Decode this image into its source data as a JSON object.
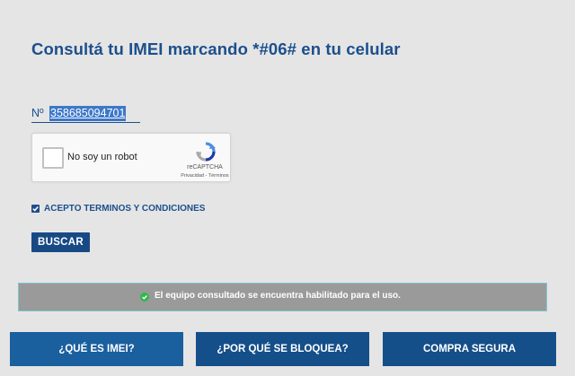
{
  "page_title": "Consultá tu IMEI marcando *#06# en tu celular",
  "imei_input": {
    "prefix": "Nº",
    "value": "358685094701"
  },
  "captcha": {
    "label": "No soy un robot",
    "brand": "reCAPTCHA",
    "links": "Privacidad - Términos"
  },
  "terms": {
    "checked": true,
    "label": "ACEPTO TERMINOS Y CONDICIONES"
  },
  "search_button": {
    "label": "BUSCAR"
  },
  "status": {
    "message": "El equipo consultado se encuentra habilitado para el uso.",
    "icon": "check-circle-icon"
  },
  "bottom_nav": [
    {
      "label": "¿QUÉ ES IMEI?"
    },
    {
      "label": "¿POR QUÉ SE BLOQUEA?"
    },
    {
      "label": "COMPRA SEGURA"
    }
  ],
  "colors": {
    "brand_blue": "#1c4f8c",
    "status_bg": "#9a9a9a",
    "success_green": "#2eb84b"
  }
}
